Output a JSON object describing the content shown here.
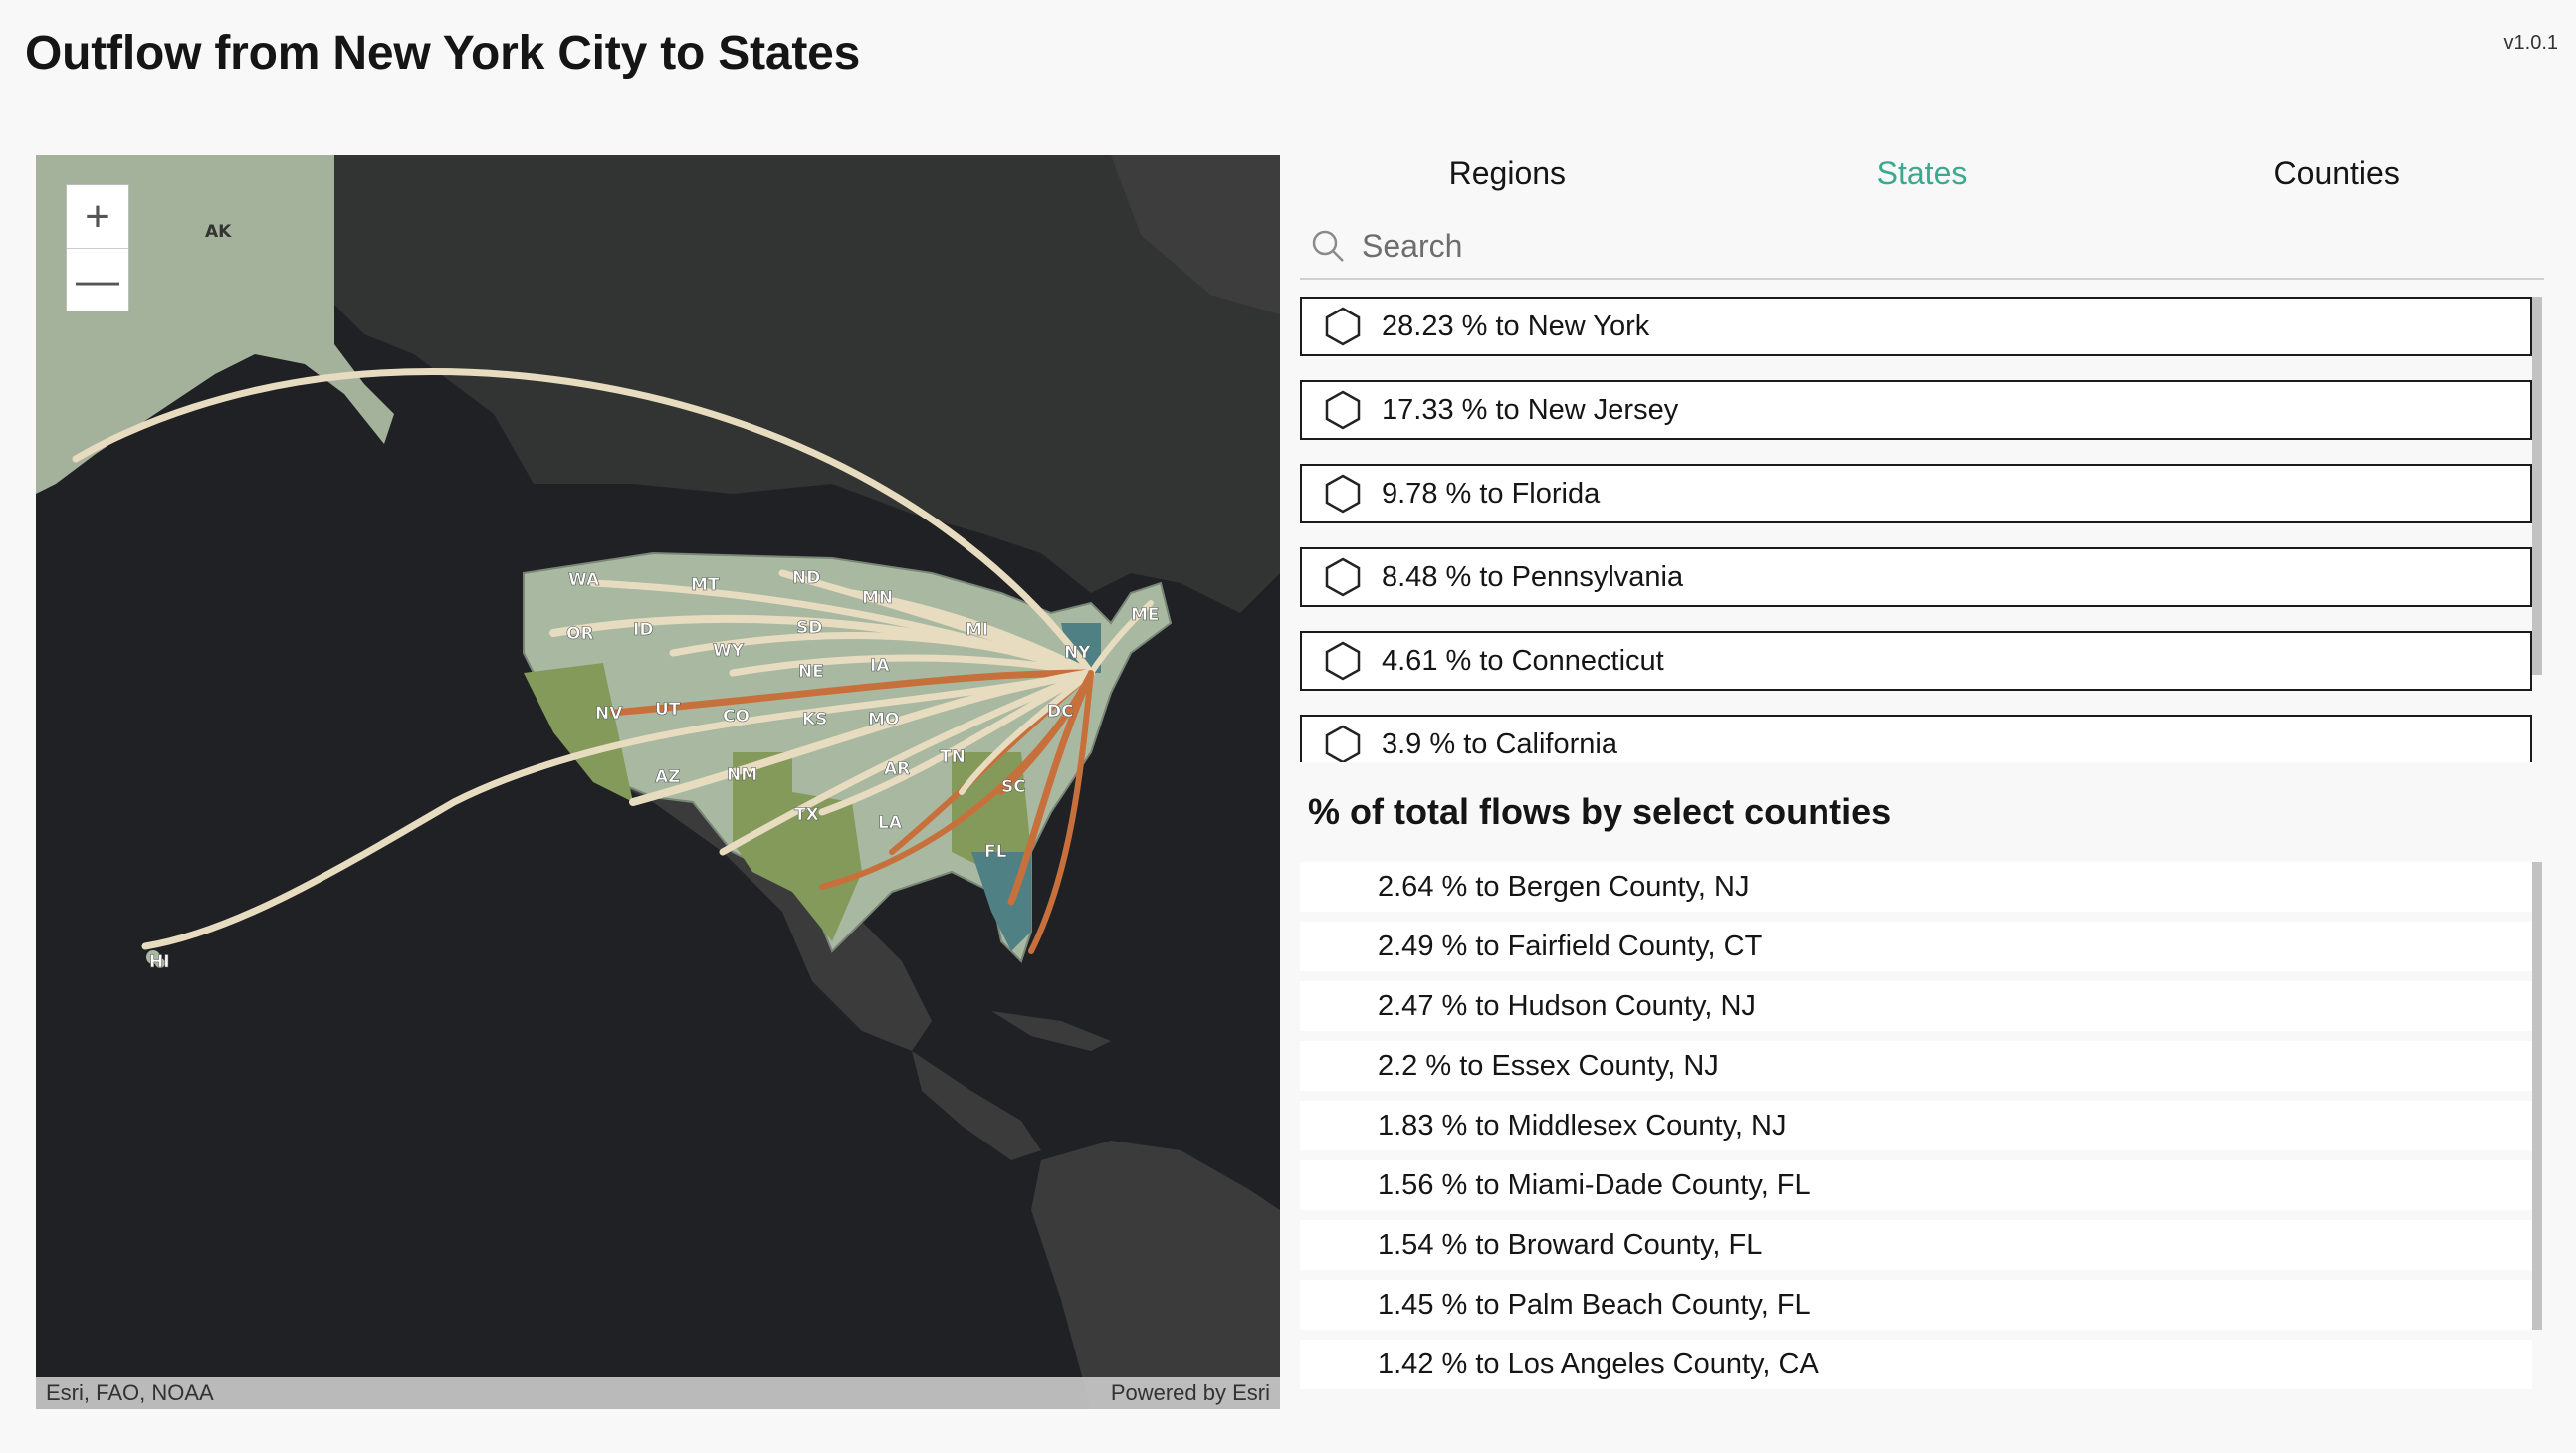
{
  "header": {
    "title": "Outflow from New York City to States",
    "version": "v1.0.1"
  },
  "map": {
    "zoom_in": "+",
    "zoom_out": "—",
    "attribution_left": "Esri, FAO, NOAA",
    "attribution_right": "Powered by Esri",
    "state_labels": [
      "AK",
      "WA",
      "MT",
      "ND",
      "MN",
      "OR",
      "ID",
      "SD",
      "WY",
      "MI",
      "NE",
      "IA",
      "NY",
      "ME",
      "NV",
      "UT",
      "CO",
      "KS",
      "MO",
      "DC",
      "TN",
      "AR",
      "AZ",
      "NM",
      "SC",
      "TX",
      "LA",
      "FL",
      "HI"
    ],
    "colors": {
      "arc_light": "#e8dcc0",
      "arc_dark": "#c8703c",
      "state_fill": "#a9b9a1",
      "state_green": "#849a5a",
      "state_teal": "#4e8084",
      "ocean": "#1f2124",
      "land": "#3a3b3a"
    }
  },
  "tabs": [
    {
      "label": "Regions",
      "active": false
    },
    {
      "label": "States",
      "active": true
    },
    {
      "label": "Counties",
      "active": false
    }
  ],
  "search": {
    "placeholder": "Search"
  },
  "states": [
    "28.23 % to New York",
    "17.33 % to New Jersey",
    "9.78 % to Florida",
    "8.48 % to Pennsylvania",
    "4.61 % to Connecticut",
    "3.9 % to California"
  ],
  "counties_title": "% of total flows by select counties",
  "counties": [
    "2.64 % to Bergen County, NJ",
    "2.49 % to Fairfield County, CT",
    "2.47 % to Hudson County, NJ",
    "2.2 % to Essex County, NJ",
    "1.83 % to Middlesex County, NJ",
    "1.56 % to Miami-Dade County, FL",
    "1.54 % to Broward County, FL",
    "1.45 % to Palm Beach County, FL",
    "1.42 % to Los Angeles County, CA"
  ],
  "accent_color": "#3aa990"
}
